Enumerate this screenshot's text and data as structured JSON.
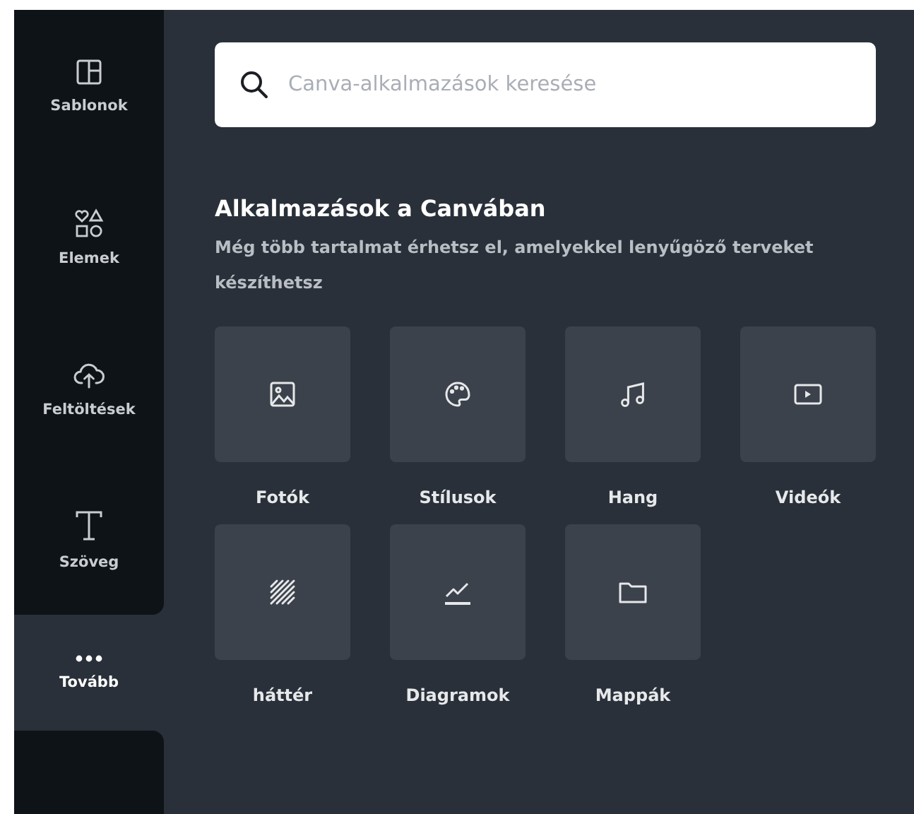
{
  "sidebar": {
    "items": [
      {
        "kind": "templates",
        "label": "Sablonok",
        "selected": false
      },
      {
        "kind": "elements",
        "label": "Elemek",
        "selected": false
      },
      {
        "kind": "upload",
        "label": "Feltöltések",
        "selected": false
      },
      {
        "kind": "text",
        "label": "Szöveg",
        "selected": false
      },
      {
        "kind": "more",
        "label": "Tovább",
        "selected": true
      }
    ]
  },
  "search": {
    "placeholder": "Canva-alkalmazások keresése"
  },
  "section": {
    "title": "Alkalmazások a Canvában",
    "subtitle": "Még több tartalmat érhetsz el, amelyekkel lenyűgöző terveket készíthetsz"
  },
  "apps": [
    {
      "kind": "image",
      "label": "Fotók"
    },
    {
      "kind": "palette",
      "label": "Stílusok"
    },
    {
      "kind": "music",
      "label": "Hang"
    },
    {
      "kind": "video",
      "label": "Videók"
    },
    {
      "kind": "pattern",
      "label": "háttér"
    },
    {
      "kind": "chart",
      "label": "Diagramok"
    },
    {
      "kind": "folder",
      "label": "Mappák"
    }
  ]
}
